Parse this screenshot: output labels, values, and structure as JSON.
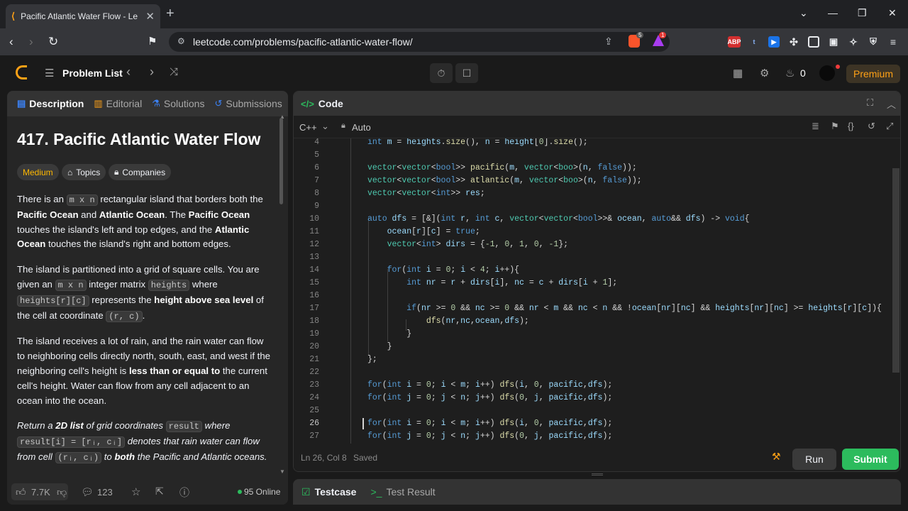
{
  "browser": {
    "tab_title": "Pacific Atlantic Water Flow - Le",
    "url": "leetcode.com/problems/pacific-atlantic-water-flow/",
    "brave_badge": "5",
    "alert_badge": "1",
    "ext_abp": "ABP",
    "ext_t": "t"
  },
  "lc_nav": {
    "problem_list": "Problem List",
    "streak": "0",
    "premium": "Premium"
  },
  "left": {
    "tabs": [
      "Description",
      "Editorial",
      "Solutions",
      "Submissions"
    ],
    "title": "417. Pacific Atlantic Water Flow",
    "difficulty": "Medium",
    "topics": "Topics",
    "companies": "Companies",
    "p1": {
      "a": "There is an ",
      "c1": "m x n",
      "b": " rectangular island that borders both the ",
      "pac": "Pacific Ocean",
      "and": " and ",
      "atl": "Atlantic Ocean",
      "c": ". The ",
      "pac2": "Pacific Ocean",
      "d": " touches the island's left and top edges, and the ",
      "atl2": "Atlantic Ocean",
      "e": " touches the island's right and bottom edges."
    },
    "p2": {
      "a": "The island is partitioned into a grid of square cells. You are given an ",
      "c1": "m x n",
      "b": " integer matrix ",
      "c2": "heights",
      "c": " where ",
      "c3": "heights[r][c]",
      "d": " represents the ",
      "bold": "height above sea level",
      "e": " of the cell at coordinate ",
      "c4": "(r, c)",
      "f": "."
    },
    "p3": {
      "a": "The island receives a lot of rain, and the rain water can flow to neighboring cells directly north, south, east, and west if the neighboring cell's height is ",
      "bold": "less than or equal to",
      "b": " the current cell's height. Water can flow from any cell adjacent to an ocean into the ocean."
    },
    "p4": {
      "a": "Return a ",
      "b1": "2D list",
      "b": " of grid coordinates ",
      "c1": "result",
      "c": " where ",
      "c2": "result[i] = [rᵢ, cᵢ]",
      "d": " denotes that rain water can flow from cell ",
      "c3": "(rᵢ, cᵢ)",
      "e": " to ",
      "b2": "both",
      "f": " the Pacific and Atlantic oceans."
    },
    "likes": "7.7K",
    "comments": "123",
    "online": "95 Online"
  },
  "code": {
    "header": "Code",
    "language": "C++",
    "autosave": "Auto",
    "status_pos": "Ln 26, Col 8",
    "status_saved": "Saved",
    "run": "Run",
    "submit": "Submit",
    "line_numbers": [
      "4",
      "5",
      "6",
      "7",
      "8",
      "9",
      "10",
      "11",
      "12",
      "13",
      "14",
      "15",
      "16",
      "17",
      "18",
      "19",
      "20",
      "21",
      "22",
      "23",
      "24",
      "25",
      "26",
      "27"
    ]
  },
  "bottom": {
    "testcase": "Testcase",
    "result": "Test Result"
  },
  "colors": {
    "accent": "#ffa116",
    "submit": "#2cbb5d",
    "panel": "#262626"
  }
}
